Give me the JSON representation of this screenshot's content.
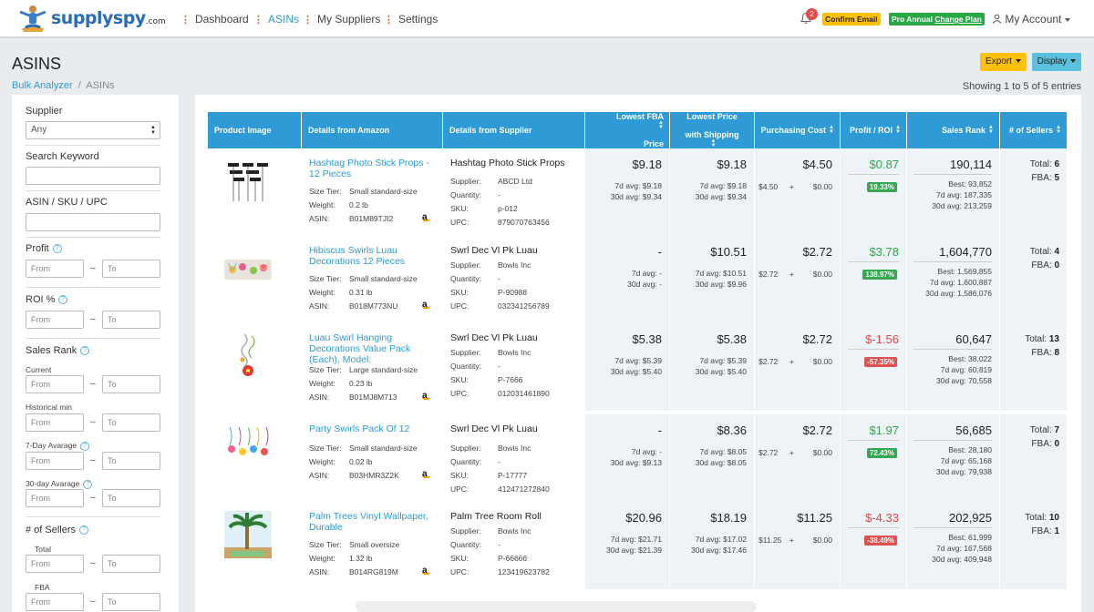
{
  "brand": {
    "name": "supplyspy",
    "suffix": ".com"
  },
  "nav": {
    "items": [
      {
        "label": "Dashboard",
        "active": false
      },
      {
        "label": "ASINs",
        "active": true
      },
      {
        "label": "My Suppliers",
        "active": false
      },
      {
        "label": "Settings",
        "active": false
      }
    ],
    "notification_count": "2",
    "confirm_email": "Confirm Email",
    "plan_label": "Pro Annual",
    "change_plan": "Change Plan",
    "account": "My Account"
  },
  "page": {
    "title": "ASINS",
    "breadcrumb_link": "Bulk Analyzer",
    "breadcrumb_sep": "/",
    "breadcrumb_current": "ASINs",
    "export": "Export",
    "display": "Display",
    "showing": "Showing 1 to 5 of 5 entries"
  },
  "filters": {
    "supplier_label": "Supplier",
    "supplier_value": "Any",
    "keyword_label": "Search Keyword",
    "asin_label": "ASIN / SKU / UPC",
    "profit_label": "Profit",
    "roi_label": "ROI %",
    "sales_rank_label": "Sales Rank",
    "current_label": "Current",
    "historical_label": "Historical min",
    "seven_day_label": "7-Day Avarage",
    "thirty_day_label": "30-day Avarage",
    "sellers_label": "# of Sellers",
    "total_label": "Total",
    "fba_label": "FBA",
    "from_placeholder": "From",
    "to_placeholder": "To",
    "dash": "–",
    "help_glyph": "?"
  },
  "table": {
    "headers": {
      "image": "Product Image",
      "amazon": "Details from Amazon",
      "supplier": "Details from Supplier",
      "fba_price_1": "Lowest FBA",
      "fba_price_2": "Price",
      "lowest_1": "Lowest Price",
      "lowest_2": "with Shipping",
      "cost": "Purchasing Cost",
      "profit": "Profit / ROI",
      "rank": "Sales Rank",
      "sellers": "# of Sellers"
    },
    "labels": {
      "size_tier": "Size Tier:",
      "weight": "Weight:",
      "asin": "ASIN:",
      "supplier": "Supplier:",
      "quantity": "Quantity:",
      "sku": "SKU:",
      "upc": "UPC:",
      "seven": "7d avg:",
      "thirty": "30d avg:",
      "best": "Best:",
      "total": "Total:",
      "fba": "FBA:",
      "plus": "+",
      "amazon_a": "a"
    },
    "rows": [
      {
        "image": "photo-props-image",
        "amazon_title": "Hashtag Photo Stick Props - 12 Pieces",
        "size_tier": "Small standard-size",
        "weight": "0.2 lb",
        "asin": "B01M89TJI2",
        "sup_title": "Hashtag Photo Stick Props",
        "sup_supplier": "ABCD Ltd",
        "sup_qty": "-",
        "sup_sku": "p-012",
        "sup_upc": "879070763456",
        "fba_price": "$9.18",
        "fba_7d": "$9.18",
        "fba_30d": "$9.34",
        "low_price": "$9.18",
        "low_7d": "$9.18",
        "low_30d": "$9.34",
        "cost": "$4.50",
        "cost_a": "$4.50",
        "cost_b": "$0.00",
        "profit": "$0.87",
        "roi": "19.33%",
        "positive": true,
        "rank": "190,114",
        "best": "93,852",
        "rank_7d": "187,335",
        "rank_30d": "213,259",
        "total": "6",
        "fba": "5"
      },
      {
        "image": "luau-swirls-image",
        "amazon_title": "Hibiscus Swirls Luau Decorations 12 Pieces",
        "size_tier": "Small standard-size",
        "weight": "0.31 lb",
        "asin": "B018M773NU",
        "sup_title": "Swrl Dec Vl Pk Luau",
        "sup_supplier": "Bowls Inc",
        "sup_qty": "-",
        "sup_sku": "P-90988",
        "sup_upc": "032341256789",
        "fba_price": "-",
        "fba_7d": "-",
        "fba_30d": "-",
        "low_price": "$10.51",
        "low_7d": "$10.51",
        "low_30d": "$9.96",
        "cost": "$2.72",
        "cost_a": "$2.72",
        "cost_b": "$0.00",
        "profit": "$3.78",
        "roi": "138.97%",
        "positive": true,
        "rank": "1,604,770",
        "best": "1,569,855",
        "rank_7d": "1,600,887",
        "rank_30d": "1,586,076",
        "total": "4",
        "fba": "0"
      },
      {
        "image": "hanging-swirl-image",
        "amazon_title": "Luau Swirl Hanging Decorations Value Pack (Each), Model:",
        "size_tier": "Large standard-size",
        "weight": "0.23 lb",
        "asin": "B01MJ8M713",
        "sup_title": "Swrl Dec Vl Pk Luau",
        "sup_supplier": "Bowls Inc",
        "sup_qty": "-",
        "sup_sku": "P-7666",
        "sup_upc": "012031461890",
        "fba_price": "$5.38",
        "fba_7d": "$5.39",
        "fba_30d": "$5.40",
        "low_price": "$5.38",
        "low_7d": "$5.39",
        "low_30d": "$5.40",
        "cost": "$2.72",
        "cost_a": "$2.72",
        "cost_b": "$0.00",
        "profit": "$-1.56",
        "roi": "-57.35%",
        "positive": false,
        "rank": "60,647",
        "best": "38,022",
        "rank_7d": "60,819",
        "rank_30d": "70,558",
        "total": "13",
        "fba": "8"
      },
      {
        "image": "party-swirls-image",
        "amazon_title": "Party Swirls Pack Of 12",
        "size_tier": "Small standard-size",
        "weight": "0.02 lb",
        "asin": "B03HMR3Z2K",
        "sup_title": "Swrl Dec Vl Pk Luau",
        "sup_supplier": "Bowls Inc",
        "sup_qty": "-",
        "sup_sku": "P-17777",
        "sup_upc": "412471272840",
        "fba_price": "-",
        "fba_7d": "-",
        "fba_30d": "$9.13",
        "low_price": "$8.36",
        "low_7d": "$8.05",
        "low_30d": "$8.05",
        "cost": "$2.72",
        "cost_a": "$2.72",
        "cost_b": "$0.00",
        "profit": "$1.97",
        "roi": "72.43%",
        "positive": true,
        "rank": "56,685",
        "best": "28,180",
        "rank_7d": "65,168",
        "rank_30d": "79,938",
        "total": "7",
        "fba": "0"
      },
      {
        "image": "palm-tree-image",
        "amazon_title": "Palm Trees Vinyl Wallpaper, Durable",
        "size_tier": "Small oversize",
        "weight": "1.32 lb",
        "asin": "B014RG819M",
        "sup_title": "Palm Tree Room Roll",
        "sup_supplier": "Bowls Inc",
        "sup_qty": "-",
        "sup_sku": "P-66666",
        "sup_upc": "123419623782",
        "fba_price": "$20.96",
        "fba_7d": "$21.71",
        "fba_30d": "$21.39",
        "low_price": "$18.19",
        "low_7d": "$17.02",
        "low_30d": "$17.46",
        "cost": "$11.25",
        "cost_a": "$11.25",
        "cost_b": "$0.00",
        "profit": "$-4.33",
        "roi": "-38.49%",
        "positive": false,
        "rank": "202,925",
        "best": "61,999",
        "rank_7d": "167,568",
        "rank_30d": "409,948",
        "total": "10",
        "fba": "1"
      }
    ]
  }
}
